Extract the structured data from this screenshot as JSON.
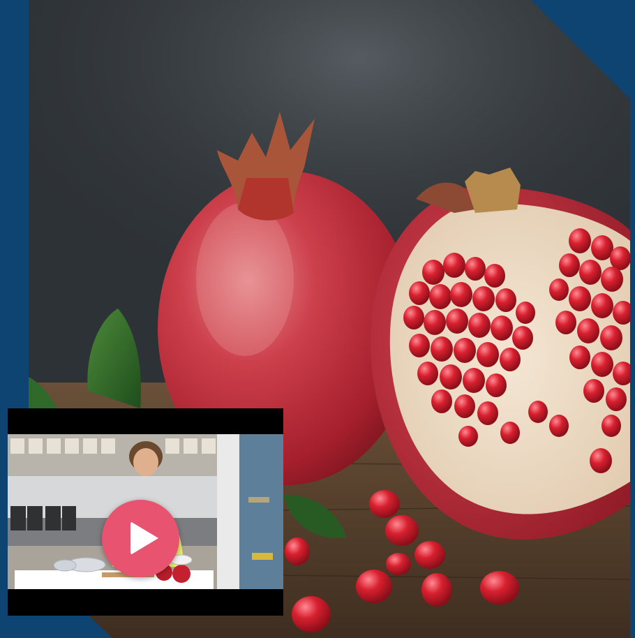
{
  "image": {
    "subject": "pomegranate-photo",
    "frame_color": "#0d4472"
  },
  "video": {
    "play_icon": "play-icon",
    "play_button_color": "#e8546f"
  }
}
